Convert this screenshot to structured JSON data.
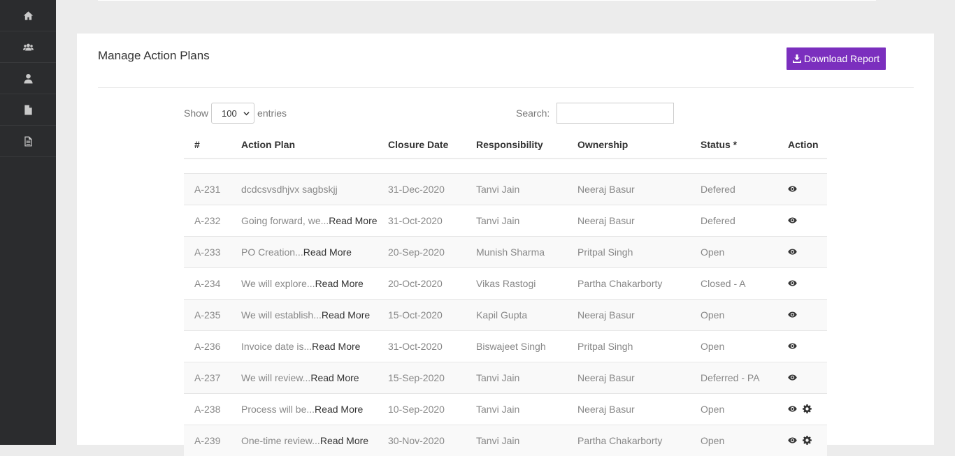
{
  "sidebar": {
    "items": [
      {
        "icon": "home-icon"
      },
      {
        "icon": "users-icon"
      },
      {
        "icon": "user-icon"
      },
      {
        "icon": "file-icon"
      },
      {
        "icon": "file-text-icon"
      }
    ]
  },
  "page": {
    "title": "Manage Action Plans",
    "download_label": "Download Report",
    "accent_color": "#7b2fbe"
  },
  "controls": {
    "show_label": "Show",
    "entries_value": "100",
    "entries_label": "entries",
    "search_label": "Search:",
    "search_value": ""
  },
  "table": {
    "columns": [
      "#",
      "Action Plan",
      "Closure Date",
      "Responsibility",
      "Ownership",
      "Status *",
      "Action"
    ],
    "read_more": "Read More",
    "rows": [
      {
        "id": "A-231",
        "plan": "dcdcsvsdhjvx sagbskjj",
        "read_more": false,
        "date": "31-Dec-2020",
        "resp": "Tanvi Jain",
        "owner": "Neeraj Basur",
        "status": "Defered",
        "settings": false
      },
      {
        "id": "A-232",
        "plan": "Going forward, we...",
        "read_more": true,
        "date": "31-Oct-2020",
        "resp": "Tanvi Jain",
        "owner": "Neeraj Basur",
        "status": "Defered",
        "settings": false
      },
      {
        "id": "A-233",
        "plan": "PO Creation...",
        "read_more": true,
        "date": "20-Sep-2020",
        "resp": "Munish Sharma",
        "owner": "Pritpal Singh",
        "status": "Open",
        "settings": false
      },
      {
        "id": "A-234",
        "plan": "We will explore...",
        "read_more": true,
        "date": "20-Oct-2020",
        "resp": "Vikas Rastogi",
        "owner": "Partha Chakarborty",
        "status": "Closed - A",
        "settings": false
      },
      {
        "id": "A-235",
        "plan": "We will establish...",
        "read_more": true,
        "date": "15-Oct-2020",
        "resp": "Kapil Gupta",
        "owner": "Neeraj Basur",
        "status": "Open",
        "settings": false
      },
      {
        "id": "A-236",
        "plan": "Invoice date is...",
        "read_more": true,
        "date": "31-Oct-2020",
        "resp": "Biswajeet Singh",
        "owner": "Pritpal Singh",
        "status": "Open",
        "settings": false
      },
      {
        "id": "A-237",
        "plan": "We will review...",
        "read_more": true,
        "date": "15-Sep-2020",
        "resp": "Tanvi Jain",
        "owner": "Neeraj Basur",
        "status": "Deferred - PA",
        "settings": false
      },
      {
        "id": "A-238",
        "plan": "Process will be...",
        "read_more": true,
        "date": "10-Sep-2020",
        "resp": "Tanvi Jain",
        "owner": "Neeraj Basur",
        "status": "Open",
        "settings": true
      },
      {
        "id": "A-239",
        "plan": "One-time review...",
        "read_more": true,
        "date": "30-Nov-2020",
        "resp": "Tanvi Jain",
        "owner": "Partha Chakarborty",
        "status": "Open",
        "settings": true
      }
    ]
  }
}
